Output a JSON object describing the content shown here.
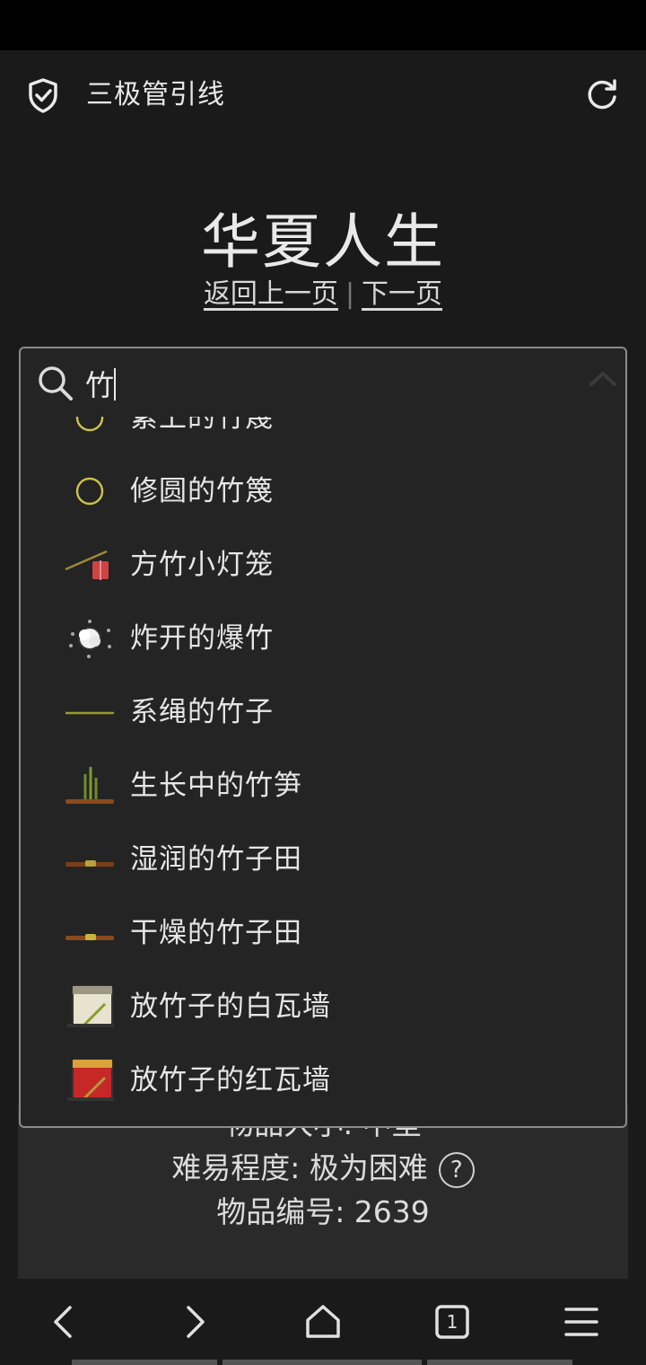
{
  "app_bar": {
    "title": "三极管引线"
  },
  "page": {
    "title": "华夏人生",
    "back_link": "返回上一页",
    "separator": "|",
    "next_link": "下一页"
  },
  "search": {
    "value": "竹",
    "placeholder": ""
  },
  "suggestions": [
    {
      "label": "紧上的竹篾",
      "icon": "bamboo-hoop-icon"
    },
    {
      "label": "修圆的竹篾",
      "icon": "bamboo-hoop-icon"
    },
    {
      "label": "方竹小灯笼",
      "icon": "lantern-icon"
    },
    {
      "label": "炸开的爆竹",
      "icon": "firecracker-burst-icon"
    },
    {
      "label": "系绳的竹子",
      "icon": "bamboo-stick-icon"
    },
    {
      "label": "生长中的竹笋",
      "icon": "bamboo-shoot-icon"
    },
    {
      "label": "湿润的竹子田",
      "icon": "bamboo-field-icon"
    },
    {
      "label": "干燥的竹子田",
      "icon": "bamboo-field-icon"
    },
    {
      "label": "放竹子的白瓦墙",
      "icon": "white-tile-wall-icon"
    },
    {
      "label": "放竹子的红瓦墙",
      "icon": "red-tile-wall-icon"
    }
  ],
  "info": {
    "size_line": "物品大小: 中型",
    "difficulty_label": "难易程度: 极为困难",
    "help_symbol": "?",
    "item_number": "物品编号: 2639"
  },
  "bottom_nav": {
    "tab_count": "1"
  },
  "colors": {
    "background": "#1a1a1a",
    "dropdown": "#242424",
    "border": "#8a8a8a",
    "text": "#e6e6e6"
  }
}
